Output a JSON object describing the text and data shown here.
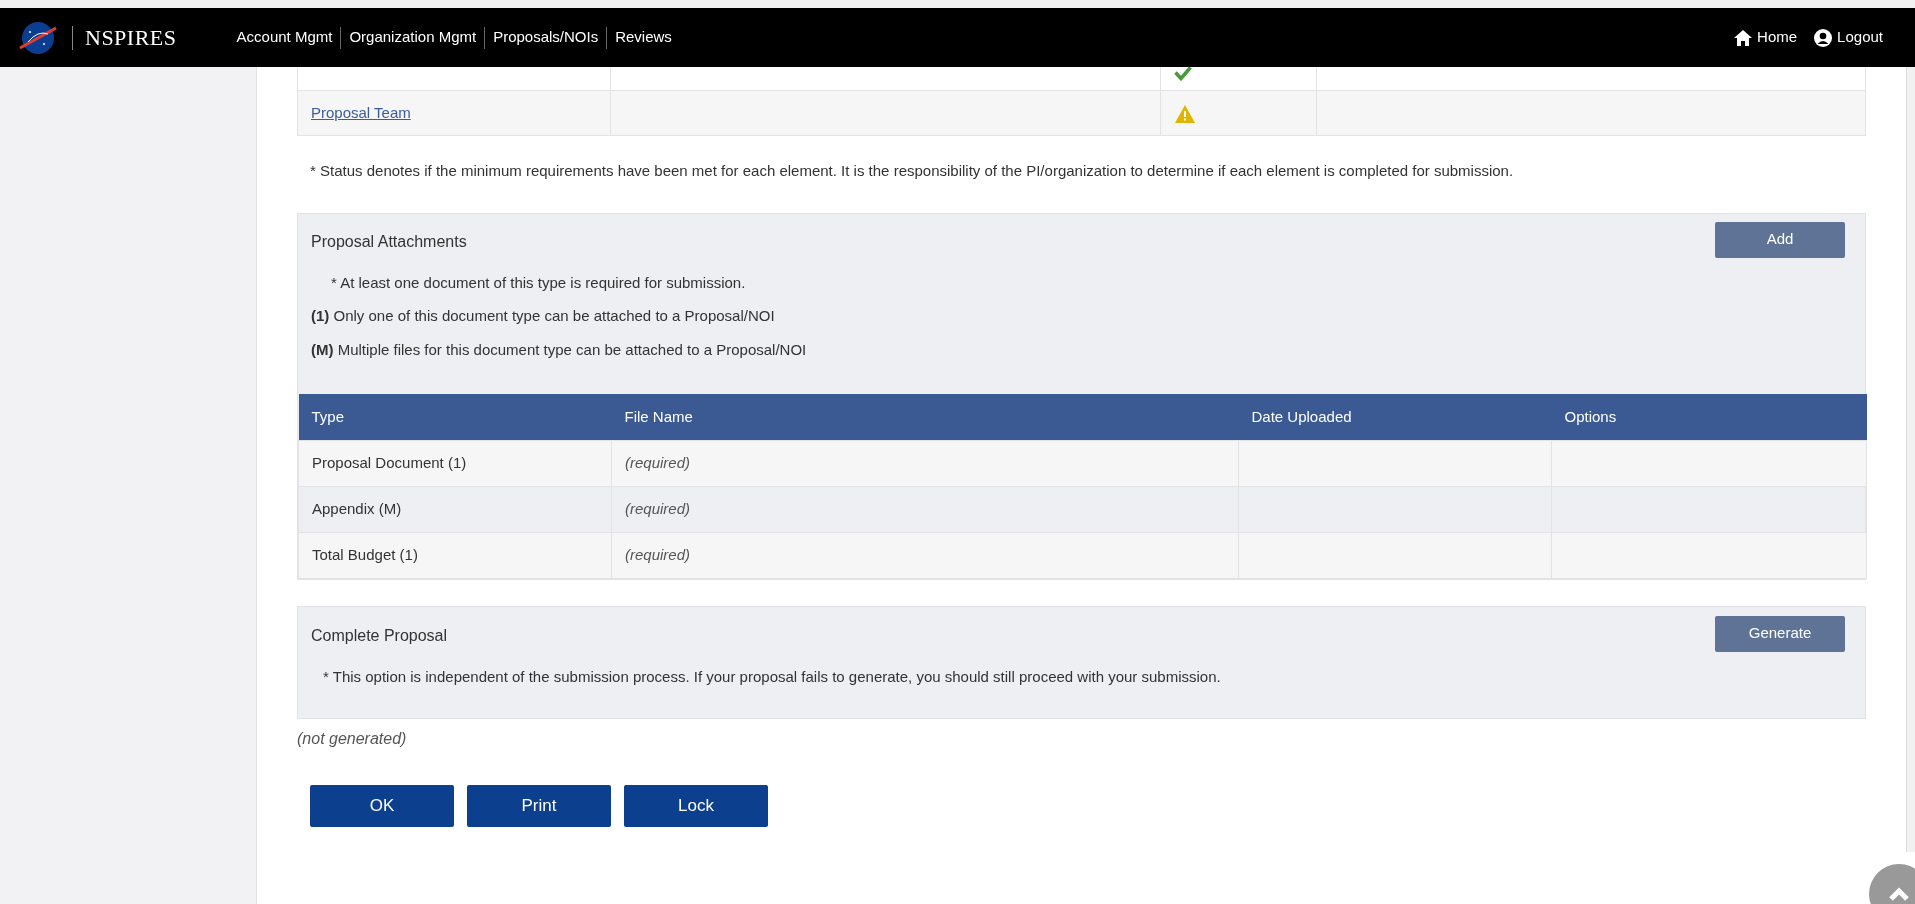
{
  "header": {
    "brand": "NSPIRES",
    "nav": [
      "Account Mgmt",
      "Organization Mgmt",
      "Proposals/NOIs",
      "Reviews"
    ],
    "right": [
      {
        "label": "Home",
        "kind": "home"
      },
      {
        "label": "Logout",
        "kind": "user"
      }
    ]
  },
  "elements": [
    {
      "kind": "ok"
    },
    {
      "name": "Proposal Team",
      "kind": "warning"
    }
  ],
  "status_note": "* Status denotes if the minimum requirements have been met for each element. It is the responsibility of the PI/organization to determine if each element is completed for submission.",
  "attachments": {
    "title": "Proposal Attachments",
    "button": "Add",
    "notes": [
      "*  At least one document of this type is required for submission.",
      "**(1)** Only one of this document type can be attached to a Proposal/NOI",
      "**(M)** Multiple files for this document type can be attached to a Proposal/NOI"
    ],
    "columns": [
      "Type",
      "File Name",
      "Date Uploaded",
      "Options"
    ],
    "rows": [
      {
        "type": "Proposal Document  (1)",
        "file": "(required)"
      },
      {
        "type": "Appendix  (M)",
        "file": "(required)"
      },
      {
        "type": "Total Budget  (1)",
        "file": "(required)"
      }
    ]
  },
  "complete": {
    "title": "Complete Proposal",
    "button": "Generate",
    "note": "* This option is independent of the submission process. If your proposal fails to generate, you should still proceed with your submission.",
    "state": "(not generated)"
  },
  "buttons": [
    "OK",
    "Print",
    "Lock"
  ]
}
